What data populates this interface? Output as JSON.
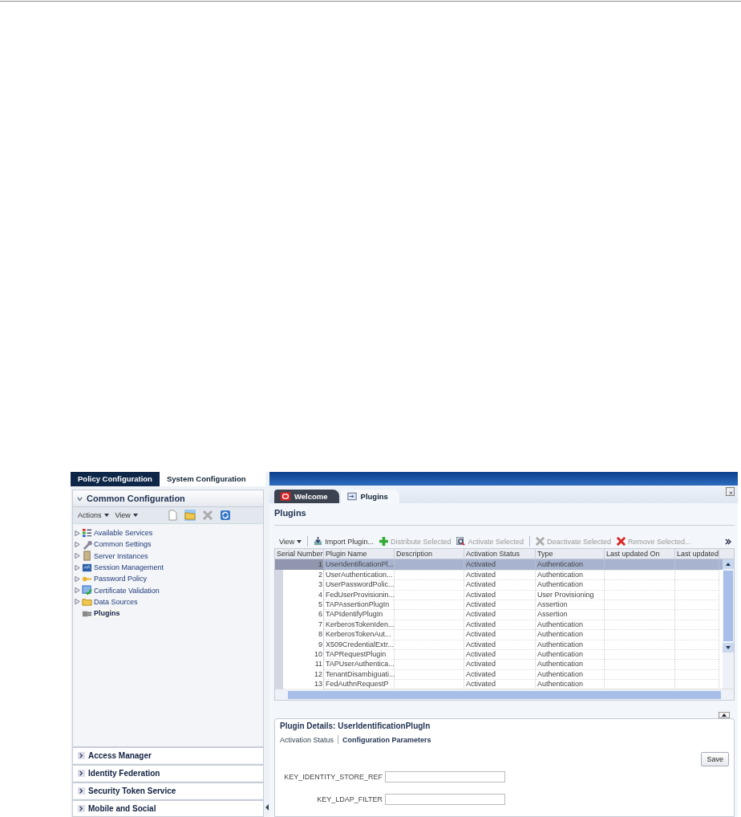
{
  "top_tabs": [
    {
      "label": "Policy Configuration",
      "selected": false
    },
    {
      "label": "System Configuration",
      "selected": true
    }
  ],
  "sidebar": {
    "title": "Common Configuration",
    "expanded": true,
    "toolbar": {
      "menus": [
        "Actions",
        "View"
      ]
    },
    "tree": [
      {
        "label": "Available Services",
        "expandable": true,
        "selected": false
      },
      {
        "label": "Common Settings",
        "expandable": true,
        "selected": false
      },
      {
        "label": "Server Instances",
        "expandable": true,
        "selected": false
      },
      {
        "label": "Session Management",
        "expandable": true,
        "selected": false
      },
      {
        "label": "Password Policy",
        "expandable": true,
        "selected": false
      },
      {
        "label": "Certificate Validation",
        "expandable": true,
        "selected": false
      },
      {
        "label": "Data Sources",
        "expandable": true,
        "selected": false
      },
      {
        "label": "Plugins",
        "expandable": false,
        "selected": true
      }
    ],
    "sections": [
      "Access Manager",
      "Identity Federation",
      "Security Token Service",
      "Mobile and Social"
    ]
  },
  "doc_tabs": [
    {
      "label": "Welcome",
      "selected": false
    },
    {
      "label": "Plugins",
      "selected": true
    }
  ],
  "page_title": "Plugins",
  "toolbar": {
    "view": "View",
    "actions": [
      {
        "label": "Import Plugin...",
        "disabled": false
      },
      {
        "label": "Distribute Selected",
        "disabled": true
      },
      {
        "label": "Activate Selected",
        "disabled": true
      },
      {
        "label": "Deactivate Selected",
        "disabled": true
      },
      {
        "label": "Remove Selected...",
        "disabled": true
      }
    ]
  },
  "table": {
    "columns": [
      "Serial Number",
      "Plugin Name",
      "Description",
      "Activation Status",
      "Type",
      "Last updated On",
      "Last updated"
    ],
    "rows": [
      {
        "serial": "1",
        "name": "UserIdentificationPl...",
        "status": "Activated",
        "type": "Authentication",
        "selected": true
      },
      {
        "serial": "2",
        "name": "UserAuthentication...",
        "status": "Activated",
        "type": "Authentication",
        "selected": false
      },
      {
        "serial": "3",
        "name": "UserPasswordPolic...",
        "status": "Activated",
        "type": "Authentication",
        "selected": false
      },
      {
        "serial": "4",
        "name": "FedUserProvisionin...",
        "status": "Activated",
        "type": "User Provisioning",
        "selected": false
      },
      {
        "serial": "5",
        "name": "TAPAssertionPlugIn",
        "status": "Activated",
        "type": "Assertion",
        "selected": false
      },
      {
        "serial": "6",
        "name": "TAPIdentifyPlugIn",
        "status": "Activated",
        "type": "Assertion",
        "selected": false
      },
      {
        "serial": "7",
        "name": "KerberosTokenIden...",
        "status": "Activated",
        "type": "Authentication",
        "selected": false
      },
      {
        "serial": "8",
        "name": "KerberosTokenAut...",
        "status": "Activated",
        "type": "Authentication",
        "selected": false
      },
      {
        "serial": "9",
        "name": "X509CredentialExtr...",
        "status": "Activated",
        "type": "Authentication",
        "selected": false
      },
      {
        "serial": "10",
        "name": "TAPRequestPlugin",
        "status": "Activated",
        "type": "Authentication",
        "selected": false
      },
      {
        "serial": "11",
        "name": "TAPUserAuthentica...",
        "status": "Activated",
        "type": "Authentication",
        "selected": false
      },
      {
        "serial": "12",
        "name": "TenantDisambiguati...",
        "status": "Activated",
        "type": "Authentication",
        "selected": false
      },
      {
        "serial": "13",
        "name": "FedAuthnRequestP",
        "status": "Activated",
        "type": "Authentication",
        "selected": false
      }
    ]
  },
  "details": {
    "title": "Plugin Details: UserIdentificationPlugIn",
    "tabs": [
      {
        "label": "Activation Status",
        "selected": false
      },
      {
        "label": "Configuration Parameters",
        "selected": true
      }
    ],
    "save": "Save",
    "fields": [
      {
        "label": "KEY_IDENTITY_STORE_REF"
      },
      {
        "label": "KEY_LDAP_FILTER"
      }
    ]
  }
}
